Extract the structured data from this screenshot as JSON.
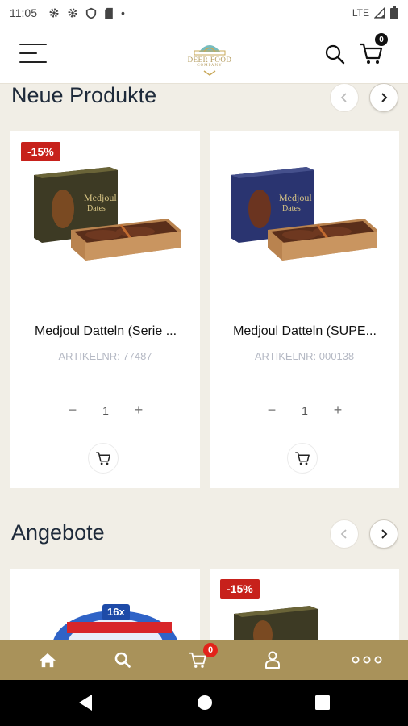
{
  "status_bar": {
    "time": "11:05",
    "network": "LTE",
    "icons": [
      "settings-gear-icon",
      "settings-gear-icon",
      "shield-icon",
      "sd-card-icon",
      "dot-icon",
      "signal-icon",
      "battery-icon"
    ]
  },
  "header": {
    "logo_alt": "logo",
    "logo_line1": "DEER FOOD",
    "logo_line2": "COMPANY",
    "cart_count": "0"
  },
  "sections": [
    {
      "title": "Neue Produkte",
      "products": [
        {
          "discount": "-15%",
          "name": "Medjoul Datteln (Serie ...",
          "sku": "ARTIKELNR: 77487",
          "qty": "1",
          "package_color": "#3d3a24"
        },
        {
          "discount": "",
          "name": "Medjoul Datteln (SUPE...",
          "sku": "ARTIKELNR: 000138",
          "qty": "1",
          "package_color": "#2a3470"
        }
      ]
    },
    {
      "title": "Angebote",
      "products": [
        {
          "discount": "",
          "package_label": "16x"
        },
        {
          "discount": "-15%"
        }
      ]
    }
  ],
  "bottom_nav": {
    "items": [
      "home-icon",
      "search-icon",
      "cart-icon",
      "user-icon",
      "more-icon"
    ],
    "cart_count": "0"
  },
  "colors": {
    "accent_gold": "#a9925a",
    "discount_red": "#c7211b",
    "title_navy": "#1e2a3a"
  }
}
